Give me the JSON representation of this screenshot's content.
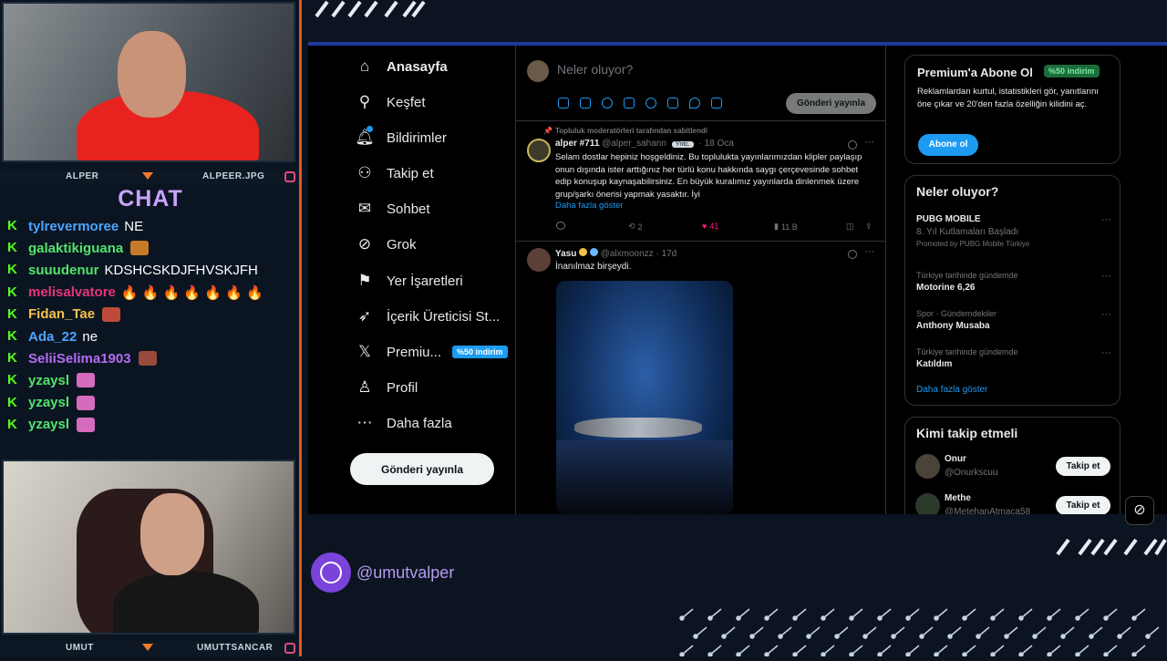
{
  "overlay": {
    "cam1_left": "ALPER",
    "cam1_right": "ALPEER.JPG",
    "cam2_left": "UMUT",
    "cam2_right": "UMUTTSANCAR",
    "chat_title": "CHAT",
    "handle": "@umutvalper",
    "chat": [
      {
        "user": "tylrevermoree",
        "msg": "NE",
        "color": "#4fa3ff"
      },
      {
        "user": "galaktikiguana",
        "msg": "",
        "color": "#53e36b"
      },
      {
        "user": "suuudenur",
        "msg": "KDSHCSKDJFHVSKJFH",
        "color": "#53e36b"
      },
      {
        "user": "melisalvatore",
        "msg": "🔥 🔥 🔥 🔥 🔥 🔥 🔥",
        "color": "#e8357a"
      },
      {
        "user": "Fidan_Tae",
        "msg": "",
        "color": "#f5c04a"
      },
      {
        "user": "Ada_22",
        "msg": "ne",
        "color": "#4fa3ff"
      },
      {
        "user": "SeliiSelima1903",
        "msg": "",
        "color": "#b56cf5"
      },
      {
        "user": "yzaysl",
        "msg": "",
        "color": "#53e36b"
      },
      {
        "user": "yzaysl",
        "msg": "",
        "color": "#53e36b"
      },
      {
        "user": "yzaysl",
        "msg": "",
        "color": "#53e36b"
      }
    ]
  },
  "nav": {
    "items": [
      {
        "label": "Anasayfa",
        "icon": "home-icon"
      },
      {
        "label": "Keşfet",
        "icon": "search-icon"
      },
      {
        "label": "Bildirimler",
        "icon": "bell-icon"
      },
      {
        "label": "Takip et",
        "icon": "add-user-icon"
      },
      {
        "label": "Sohbet",
        "icon": "mail-icon"
      },
      {
        "label": "Grok",
        "icon": "grok-icon"
      },
      {
        "label": "Yer İşaretleri",
        "icon": "bookmark-icon"
      },
      {
        "label": "İçerik Üreticisi St...",
        "icon": "rocket-icon"
      },
      {
        "label": "Premiu...",
        "icon": "x-logo-icon",
        "badge": "%50 indirim"
      },
      {
        "label": "Profil",
        "icon": "person-icon"
      },
      {
        "label": "Daha fazla",
        "icon": "more-icon"
      }
    ],
    "post_button": "Gönderi yayınla"
  },
  "compose": {
    "placeholder": "Neler oluyor?",
    "post_button": "Gönderi yayınla"
  },
  "posts": [
    {
      "pinned_note": "Topluluk moderatörleri tarafından sabitlendi",
      "author": "alper #711",
      "handle": "@alper_sahann",
      "badge": "Yntc.",
      "date": "· 18 Oca",
      "text": "Selam dostlar hepiniz hoşgeldiniz. Bu toplulukta yayınlarımızdan klipler paylaşıp onun dışında ister arttığınız her türlü konu hakkında saygı çerçevesinde sohbet edip konuşup kaynaşabilirsiniz. En büyük kuralımız yayınlarda dinlenmek üzere grup/şarkı önerisi yapmak yasaktır. İyi",
      "show_more": "Daha fazla göster",
      "retweets": "2",
      "likes": "41",
      "views": "11 B"
    },
    {
      "author": "Yasu",
      "handle": "@alxmoonzz",
      "date": "· 17d",
      "text": "İnanılmaz birşeydi."
    }
  ],
  "premium": {
    "title": "Premium'a Abone Ol",
    "badge": "%50 indirim",
    "desc": "Reklamlardan kurtul, istatistikleri gör, yanıtlarını öne çıkar ve 20'den fazla özelliğin kilidini aç.",
    "button": "Abone ol"
  },
  "trends": {
    "title": "Neler oluyor?",
    "items": [
      {
        "context": "",
        "name": "PUBG MOBILE",
        "sub": "8. Yıl Kutlamaları Başladı",
        "promo": "Promoted by PUBG Mobile Türkiye"
      },
      {
        "context": "Türkiye tarihinde gündemde",
        "name": "Motorine 6,26"
      },
      {
        "context": "Spor · Gündemdekiler",
        "name": "Anthony Musaba"
      },
      {
        "context": "Türkiye tarihinde gündemde",
        "name": "Katıldım"
      }
    ],
    "show_more": "Daha fazla göster"
  },
  "who_to_follow": {
    "title": "Kimi takip etmeli",
    "users": [
      {
        "name": "Onur",
        "handle": "@Onurkscuu",
        "button": "Takip et"
      },
      {
        "name": "Methe",
        "handle": "@MetehanAtmaca58",
        "button": "Takip et"
      }
    ]
  },
  "colors": {
    "accent": "#1d9bf0",
    "like": "#f91880",
    "frame": "#1e3b9c"
  }
}
